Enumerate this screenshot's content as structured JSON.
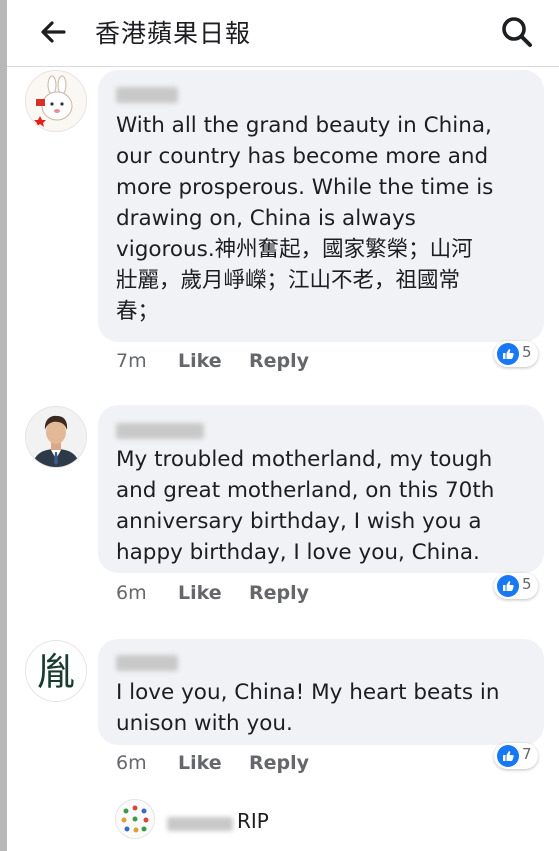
{
  "header": {
    "title": "香港蘋果日報"
  },
  "comments": [
    {
      "text": "With all the grand beauty in China,\nour country has become more and\nmore prosperous. While the time is\ndrawing on, China is always\nvigorous.神州奮起，國家繁榮；山河\n壯麗，歲月崢嶸；江山不老，祖國常\n春；",
      "time": "7m",
      "like_label": "Like",
      "reply_label": "Reply",
      "reaction_count": "5"
    },
    {
      "text": "My troubled motherland, my tough\nand great motherland, on this 70th\nanniversary birthday, I wish you a\nhappy birthday, I love you, China.",
      "time": "6m",
      "like_label": "Like",
      "reply_label": "Reply",
      "reaction_count": "5"
    },
    {
      "text": "I love you, China! My heart beats in\nunison with you.",
      "time": "6m",
      "like_label": "Like",
      "reply_label": "Reply",
      "reaction_count": "7",
      "avatar_glyph": "胤"
    }
  ],
  "reply_preview": {
    "text": "RIP"
  },
  "colors": {
    "bubble": "#f0f2f5",
    "like_blue": "#1877f2",
    "meta_gray": "#65676b"
  },
  "icons": {
    "back": "arrow-left-icon",
    "search": "search-icon",
    "reaction": "thumbs-up-icon"
  }
}
